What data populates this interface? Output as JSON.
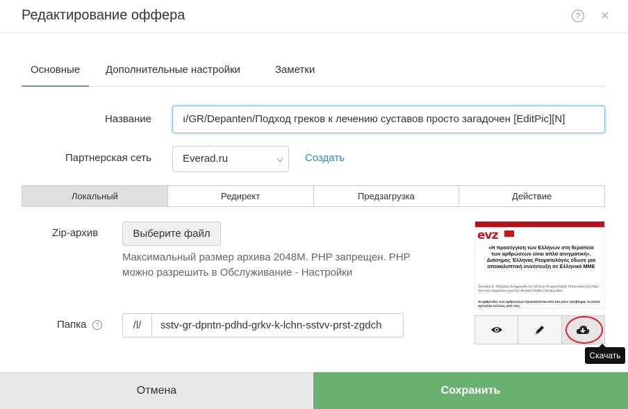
{
  "dialog": {
    "title": "Редактирование оффера",
    "help_glyph": "?",
    "close_glyph": "×"
  },
  "tabs": [
    {
      "label": "Основные",
      "active": true
    },
    {
      "label": "Дополнительные настройки",
      "active": false
    },
    {
      "label": "Заметки",
      "active": false
    }
  ],
  "form": {
    "name_label": "Название",
    "name_value": "ı/GR/Depanten/Подход греков к лечению суставов просто загадочен [EditPic][N]",
    "network_label": "Партнерская сеть",
    "network_value": "Everad.ru",
    "create_link": "Создать"
  },
  "mode_tabs": [
    {
      "label": "Локальный",
      "active": true
    },
    {
      "label": "Редирект",
      "active": false
    },
    {
      "label": "Предзагрузка",
      "active": false
    },
    {
      "label": "Действие",
      "active": false
    }
  ],
  "zip": {
    "label": "Zip-архив",
    "button": "Выберите файл",
    "help": "Максимальный размер архива 2048M. PHP запрещен. PHP можно разрешить в Обслуживание - Настройки"
  },
  "folder": {
    "label": "Папка",
    "help_glyph": "?",
    "prefix": "/l/",
    "value": "sstv-gr-dpntn-pdhd-grkv-k-lchn-sstvv-prst-zgdch"
  },
  "preview": {
    "logo": "evz",
    "headline": "«Η προσέγγιση των Ελλήνων στη θεραπεία των αρθρώσεων είναι απλά αινιγματική». Διάσημος Έλληνας Ρευματολόγος έδωσε μια αποκαλυπτική συνέντευξη σε Ελληνικό ΜΜΕ",
    "paragraph": "Λευτέρης Κ. Χιτζόγλου Ενημερώθη του Κέντρου Ρευματολογίας Τυποποίηση Στο Παρ-ΟΗ στην παραπάνω γνωστή ελληνική Όλοθιοί στα Βερολίνο",
    "paragraph2": "Οι αρθρίτιδες των αρθρώσεων προκαλούνται από ένα μόνο πρόβλημα, το οποίο αγνοείται εντελώς από τους"
  },
  "actions": [
    {
      "icon": "eye-icon",
      "label": "Просмотр"
    },
    {
      "icon": "pencil-icon",
      "label": "Редактировать"
    },
    {
      "icon": "cloud-download-icon",
      "label": "Скачать"
    }
  ],
  "tooltip": "Скачать",
  "footer": {
    "cancel": "Отмена",
    "save": "Сохранить",
    "save_color": "#6ab06f"
  }
}
